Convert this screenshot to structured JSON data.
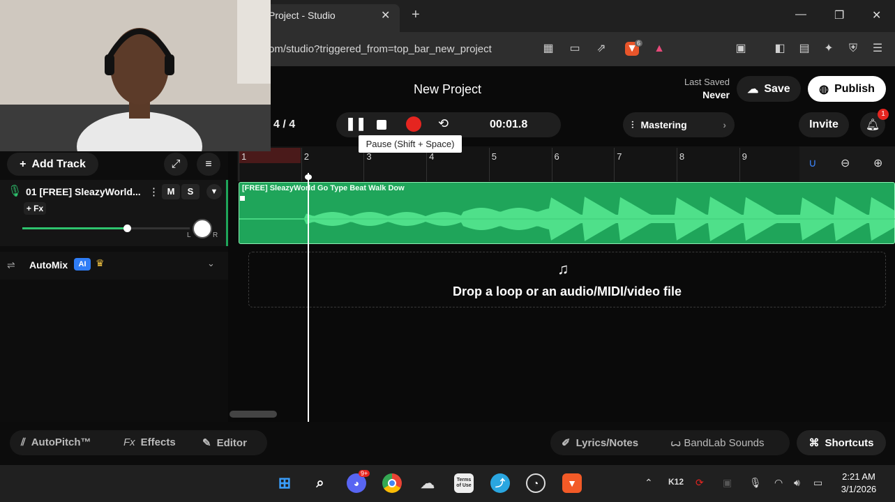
{
  "browser": {
    "tab_title": "Project - Studio",
    "tab_close": "✕",
    "new_tab": "+",
    "url": "om/studio?triggered_from=top_bar_new_project",
    "shield_count": "6"
  },
  "header": {
    "project_title": "New Project",
    "last_saved_label": "Last Saved",
    "last_saved_value": "Never",
    "save_label": "Save",
    "publish_label": "Publish",
    "invite_label": "Invite",
    "notification_count": "1"
  },
  "transport": {
    "time_signature": "4 / 4",
    "time": "00:01.8",
    "tooltip": "Pause (Shift + Space)",
    "mastering_label": "Mastering"
  },
  "tracks_panel": {
    "add_track_label": "Add Track",
    "track": {
      "name": "01  [FREE] SleazyWorld...",
      "mute": "M",
      "solo": "S",
      "fx": "+ Fx",
      "pan_left": "L",
      "pan_right": "R",
      "volume_level": 0.6
    },
    "automix": {
      "label": "AutoMix",
      "ai_badge": "AI"
    }
  },
  "timeline": {
    "bars": [
      "1",
      "2",
      "3",
      "4",
      "5",
      "6",
      "7",
      "8",
      "9"
    ],
    "clip_title": "[FREE] SleazyWorld Go Type Beat Walk Dow",
    "drop_text": "Drop a loop or an audio/MIDI/video file"
  },
  "bottom_bar": {
    "autopitch": "AutoPitch™",
    "effects_prefix": "Fx",
    "effects": "Effects",
    "editor": "Editor",
    "lyrics": "Lyrics/Notes",
    "bandlab_sounds": "BandLab Sounds",
    "shortcuts": "Shortcuts"
  },
  "taskbar": {
    "discord_badge": "9+",
    "terms_icon_text": "Terms of Use",
    "k12": "K12",
    "time": "2:21 AM",
    "date": "3/1/2026"
  },
  "colors": {
    "clip_green": "#1fa55a",
    "record_red": "#e52520",
    "ai_blue": "#2f7df6"
  }
}
